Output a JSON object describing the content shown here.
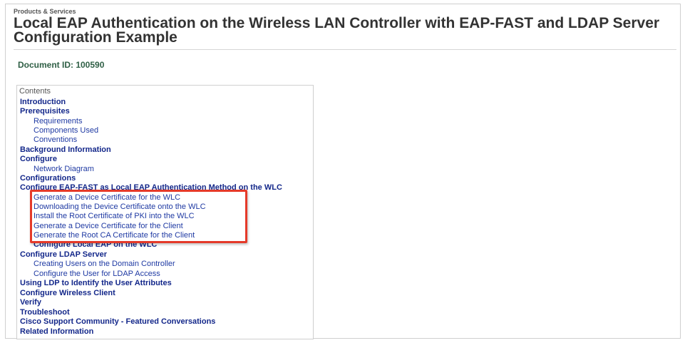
{
  "breadcrumb": "Products & Services",
  "title": "Local EAP Authentication on the Wireless LAN Controller with EAP-FAST and LDAP Server Configuration Example",
  "document_id": "Document ID: 100590",
  "contents": {
    "label": "Contents",
    "items": [
      {
        "label": "Introduction",
        "level": 1
      },
      {
        "label": "Prerequisites",
        "level": 1
      },
      {
        "label": "Requirements",
        "level": 2
      },
      {
        "label": "Components Used",
        "level": 2
      },
      {
        "label": "Conventions",
        "level": 2
      },
      {
        "label": "Background Information",
        "level": 1
      },
      {
        "label": "Configure",
        "level": 1
      },
      {
        "label": "Network Diagram",
        "level": 2
      },
      {
        "label": "Configurations",
        "level": 1
      },
      {
        "label": "Configure EAP-FAST as Local EAP Authentication Method on the WLC",
        "level": 1
      },
      {
        "label": "Generate a Device Certificate for the WLC",
        "level": 2
      },
      {
        "label": "Downloading the Device Certificate onto the WLC",
        "level": 2
      },
      {
        "label": "Install the Root Certificate of PKI into the WLC",
        "level": 2
      },
      {
        "label": "Generate a Device Certificate for the Client",
        "level": 2
      },
      {
        "label": "Generate the Root CA Certificate for the Client",
        "level": 2
      },
      {
        "label": "Configure Local EAP on the WLC",
        "level": 2
      },
      {
        "label": "Configure LDAP Server",
        "level": 1
      },
      {
        "label": "Creating Users on the Domain Controller",
        "level": 2
      },
      {
        "label": "Configure the User for LDAP Access",
        "level": 2
      },
      {
        "label": "Using LDP to Identify the User Attributes",
        "level": 1
      },
      {
        "label": "Configure Wireless Client",
        "level": 1
      },
      {
        "label": "Verify",
        "level": 1
      },
      {
        "label": "Troubleshoot",
        "level": 1
      },
      {
        "label": "Cisco Support Community - Featured Conversations",
        "level": 1
      },
      {
        "label": "Related Information",
        "level": 1
      }
    ]
  },
  "highlight_color": "#e53a29",
  "link_color": "#13278a"
}
